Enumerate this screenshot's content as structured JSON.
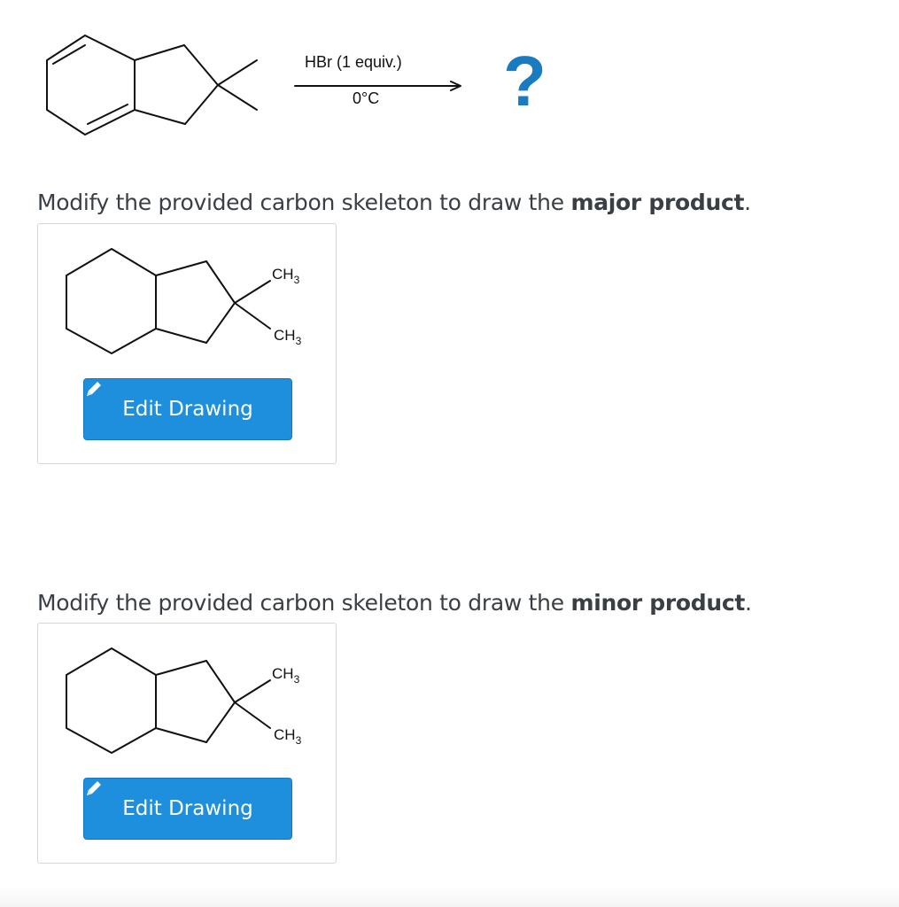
{
  "reaction": {
    "reagent": "HBr (1 equiv.)",
    "condition": "0°C",
    "product_placeholder": "?"
  },
  "sections": [
    {
      "prompt_prefix": "Modify the provided carbon skeleton to draw the ",
      "prompt_emphasis": "major product",
      "prompt_suffix": ".",
      "label_top": "CH",
      "label_bottom": "CH",
      "subscript": "3",
      "button_label": "Edit Drawing"
    },
    {
      "prompt_prefix": "Modify the provided carbon skeleton to draw the ",
      "prompt_emphasis": "minor product",
      "prompt_suffix": ".",
      "label_top": "CH",
      "label_bottom": "CH",
      "subscript": "3",
      "button_label": "Edit Drawing"
    }
  ],
  "colors": {
    "button": "#1d8fdc",
    "question_mark": "#1a7cc0",
    "text": "#3a3f45"
  },
  "icons": {
    "edit": "pencil-icon"
  }
}
